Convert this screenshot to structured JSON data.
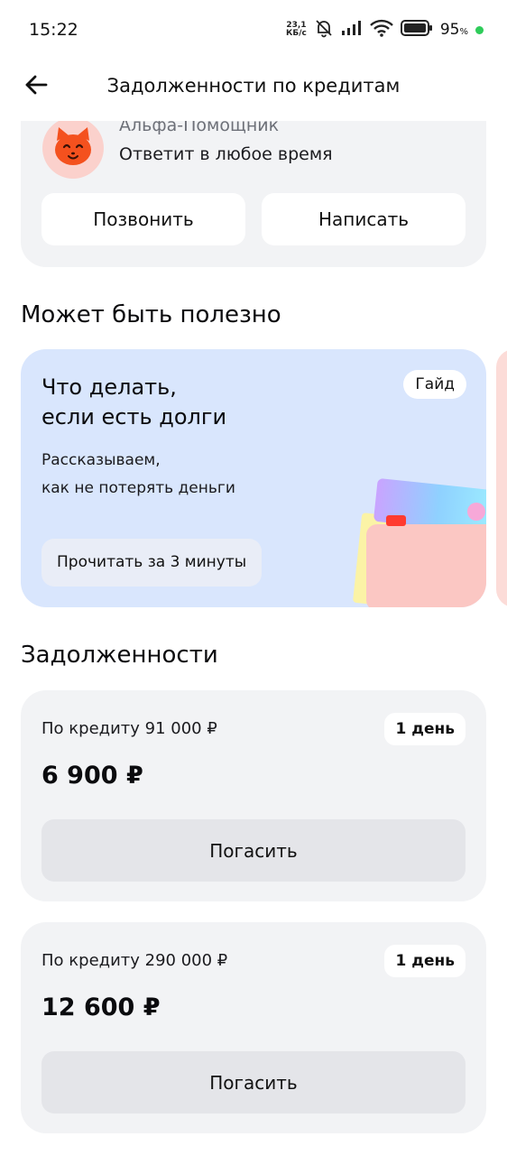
{
  "status_bar": {
    "time": "15:22",
    "net_speed_value": "23,1",
    "net_speed_unit": "КБ/с",
    "battery_percent": "95",
    "battery_unit": "%"
  },
  "header": {
    "title": "Задолженности по кредитам",
    "back_icon": "arrow-left-icon"
  },
  "assistant": {
    "name": "Альфа-Помощник",
    "subtitle": "Ответит в любое время",
    "call_label": "Позвонить",
    "write_label": "Написать",
    "avatar_icon": "cat-face-icon"
  },
  "useful": {
    "title": "Может быть полезно",
    "card": {
      "title_line1": "Что делать,",
      "title_line2": "если есть долги",
      "badge": "Гайд",
      "desc_line1": "Рассказываем,",
      "desc_line2": "как не потерять деньги",
      "button": "Прочитать за 3 минуты",
      "bg_color": "#d9e6fd"
    }
  },
  "debts": {
    "title": "Задолженности",
    "items": [
      {
        "label": "По кредиту 91 000 ₽",
        "days": "1 день",
        "amount": "6 900 ₽",
        "button": "Погасить"
      },
      {
        "label": "По кредиту 290 000 ₽",
        "days": "1 день",
        "amount": "12 600 ₽",
        "button": "Погасить"
      }
    ]
  },
  "colors": {
    "card_bg": "#f2f3f5",
    "accent_green_dot": "#2ecc5a"
  }
}
